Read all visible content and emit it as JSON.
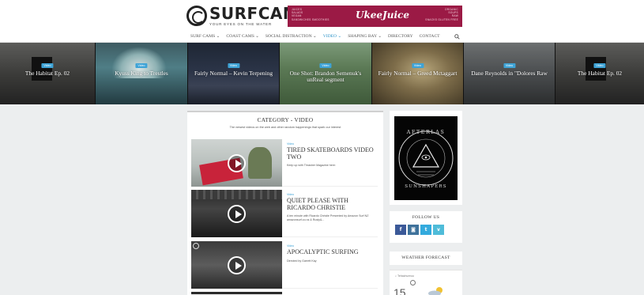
{
  "header": {
    "logo_name": "SURFCAM",
    "logo_tagline": "YOUR EYES ON THE WATER"
  },
  "ad": {
    "brand": "UkeeJuice",
    "left_lines": [
      "JUICES",
      "SALADS",
      "VEGAN",
      "SANDWICHES   SMOOTHIES"
    ],
    "right_lines": [
      "ORGANIC",
      "SOUPS",
      "RAW",
      "SNACKS   GLUTEN FREE"
    ]
  },
  "nav": {
    "items": [
      "SURF CAMS ⌄",
      "COAST CAMS ⌄",
      "SOCIAL DISTRACTION ⌄",
      "VIDEO ⌄",
      "SHAPING BAY ⌄",
      "DIRECTORY",
      "CONTACT"
    ],
    "active_index": 3,
    "search_icon": "search-icon"
  },
  "slider": {
    "slides": [
      {
        "badge": "Video",
        "title": "The Habitat Ep. 02"
      },
      {
        "badge": "Video",
        "title": "Kyuss King to Trestles"
      },
      {
        "badge": "Video",
        "title": "Fairly Normal – Kevin Terpening"
      },
      {
        "badge": "Video",
        "title": "One Shot: Brandon Semenuk's unReal segment"
      },
      {
        "badge": "Video",
        "title": "Fairly Normal – Greed Mctaggart"
      },
      {
        "badge": "Video",
        "title": "Dane Reynolds in \"Dolores Raw"
      },
      {
        "badge": "Video",
        "title": "The Habitat Ep. 02"
      }
    ]
  },
  "category": {
    "title": "CATEGORY - VIDEO",
    "subtitle": "The newest videos on the web and other random happenings that spark our interest"
  },
  "posts": [
    {
      "category": "Video",
      "title": "TIRED SKATEBOARDS VIDEO TWO",
      "excerpt": "Keep up with Thrasher Magazine here:"
    },
    {
      "category": "Video",
      "title": "QUIET PLEASE WITH RICARDO CHRISTIE",
      "excerpt": "A ten minute with Ricardo Christie Presented by Amazon Surf NZ amazonsurf.co.nz & Rusty&..."
    },
    {
      "category": "Video",
      "title": "APOCALYPTIC SURFING",
      "excerpt": "Directed by Garrett Kay"
    }
  ],
  "sidebar": {
    "ad_text_top": "AFTERLAS",
    "ad_text_bottom": "SUNSHAPERS",
    "follow_title": "FOLLOW US",
    "social": [
      {
        "icon": "facebook-icon",
        "glyph": "f",
        "color": "#3b5998"
      },
      {
        "icon": "instagram-icon",
        "glyph": "◙",
        "color": "#3f729b"
      },
      {
        "icon": "twitter-icon",
        "glyph": "t",
        "color": "#33aadd"
      },
      {
        "icon": "vimeo-icon",
        "glyph": "v",
        "color": "#4fbcd9"
      }
    ],
    "weather_title": "WEATHER FORECAST",
    "weather_location": "Tehachureuu",
    "weather_temp": "15"
  }
}
